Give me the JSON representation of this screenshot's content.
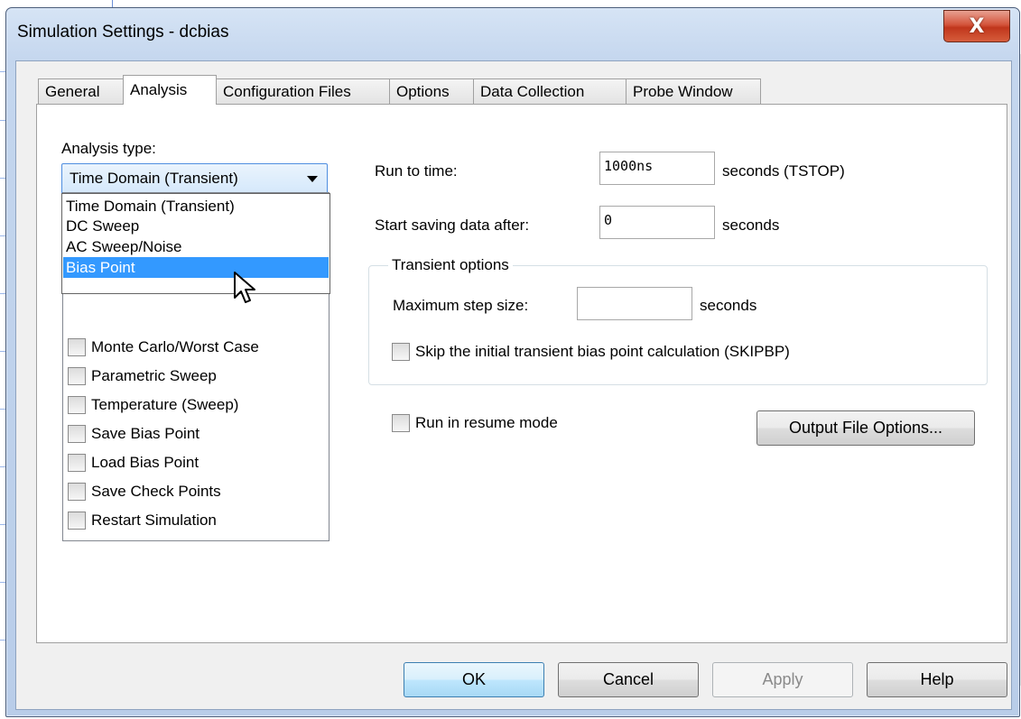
{
  "window": {
    "title": "Simulation Settings - dcbias",
    "close_glyph": "X"
  },
  "tabs": [
    {
      "label": "General",
      "active": false
    },
    {
      "label": "Analysis",
      "active": true
    },
    {
      "label": "Configuration Files",
      "active": false
    },
    {
      "label": "Options",
      "active": false
    },
    {
      "label": "Data Collection",
      "active": false
    },
    {
      "label": "Probe Window",
      "active": false
    }
  ],
  "analysis": {
    "type_label": "Analysis type:",
    "type_selected": "Time Domain (Transient)",
    "type_options": [
      "Time Domain (Transient)",
      "DC Sweep",
      "AC Sweep/Noise",
      "Bias Point"
    ],
    "type_highlighted": "Bias Point",
    "options_list": [
      {
        "label": "Monte Carlo/Worst Case",
        "checked": false
      },
      {
        "label": "Parametric Sweep",
        "checked": false
      },
      {
        "label": "Temperature (Sweep)",
        "checked": false
      },
      {
        "label": "Save Bias Point",
        "checked": false
      },
      {
        "label": "Load Bias Point",
        "checked": false
      },
      {
        "label": "Save Check Points",
        "checked": false
      },
      {
        "label": "Restart Simulation",
        "checked": false
      }
    ]
  },
  "run_to_time": {
    "label": "Run to time:",
    "value": "1000ns",
    "unit": "seconds  (TSTOP)"
  },
  "start_saving": {
    "label": "Start saving data after:",
    "value": "0",
    "unit": "seconds"
  },
  "transient_options": {
    "legend": "Transient options",
    "max_step_label": "Maximum step size:",
    "max_step_value": "",
    "max_step_unit": "seconds",
    "skip_bias_label": "Skip the initial transient bias point calculation  (SKIPBP)",
    "skip_bias_checked": false
  },
  "resume_mode": {
    "label": "Run in resume mode",
    "checked": false
  },
  "buttons": {
    "output_file_options": "Output File Options...",
    "ok": "OK",
    "cancel": "Cancel",
    "apply": "Apply",
    "help": "Help"
  },
  "colors": {
    "selection": "#3399ff",
    "close_button": "#c0361c",
    "default_button_border": "#3c7fb1"
  }
}
